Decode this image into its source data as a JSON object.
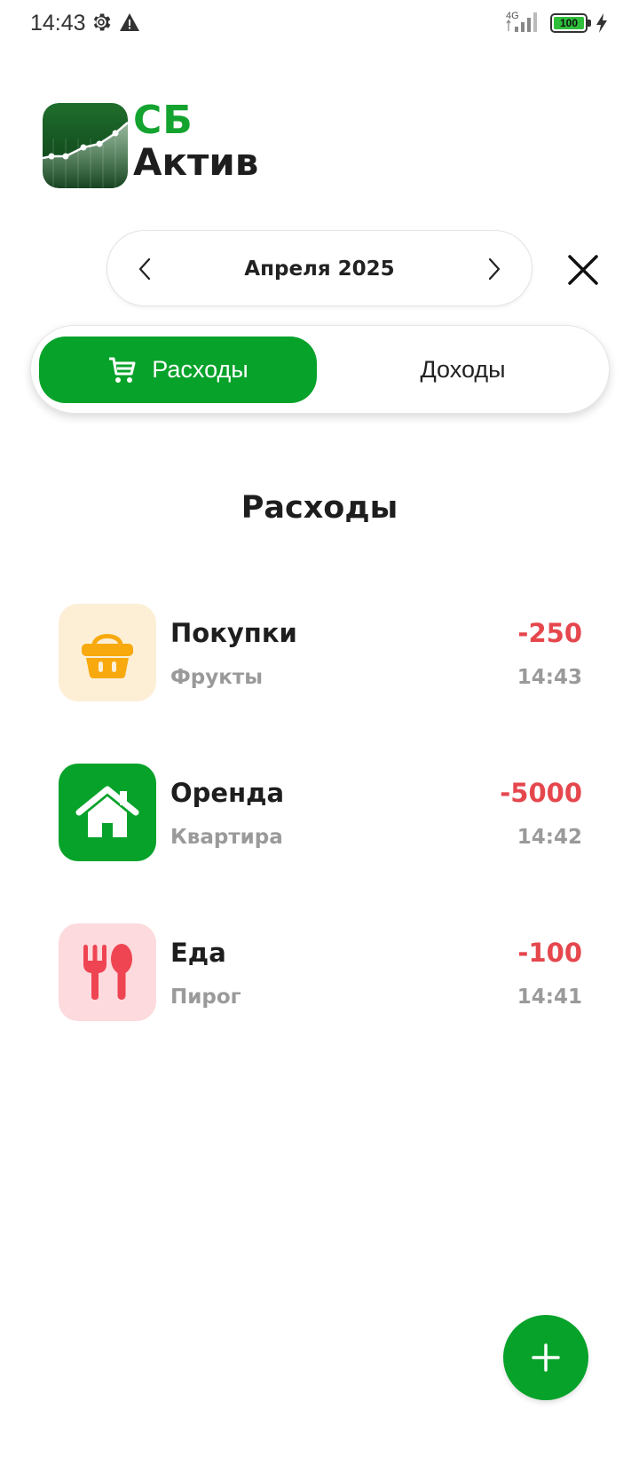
{
  "status_bar": {
    "time": "14:43",
    "network": "4G",
    "battery": "100",
    "battery_level": 1.0,
    "icons": [
      "settings-gear-icon",
      "warning-icon",
      "signal-icon",
      "battery-icon",
      "charging-bolt-icon"
    ]
  },
  "logo": {
    "line1": "СБ",
    "line2": "Актив",
    "icon": "growth-chart-icon"
  },
  "month_selector": {
    "label": "Апреля 2025",
    "prev_icon": "chevron-left-icon",
    "next_icon": "chevron-right-icon"
  },
  "close_icon": "close-icon",
  "tabs": [
    {
      "label": "Расходы",
      "icon": "cart-icon",
      "active": true
    },
    {
      "label": "Доходы",
      "active": false
    }
  ],
  "section_title": "Расходы",
  "transactions": [
    {
      "title": "Покупки",
      "subtitle": "Фрукты",
      "amount": "-250",
      "time": "14:43",
      "icon": "basket-icon",
      "icon_bg": "#fcefd6",
      "icon_color": "#f7a90e"
    },
    {
      "title": "Оренда",
      "subtitle": "Квартира",
      "amount": "-5000",
      "time": "14:42",
      "icon": "house-icon",
      "icon_bg": "#07a22a",
      "icon_color": "#ffffff"
    },
    {
      "title": "Еда",
      "subtitle": "Пирог",
      "amount": "-100",
      "time": "14:41",
      "icon": "fork-spoon-icon",
      "icon_bg": "#fcdadd",
      "icon_color": "#ef4452"
    }
  ],
  "fab": {
    "icon": "plus-icon"
  },
  "colors": {
    "accent": "#07a22a",
    "expense": "#e5474d",
    "muted": "#9a9a9a"
  }
}
